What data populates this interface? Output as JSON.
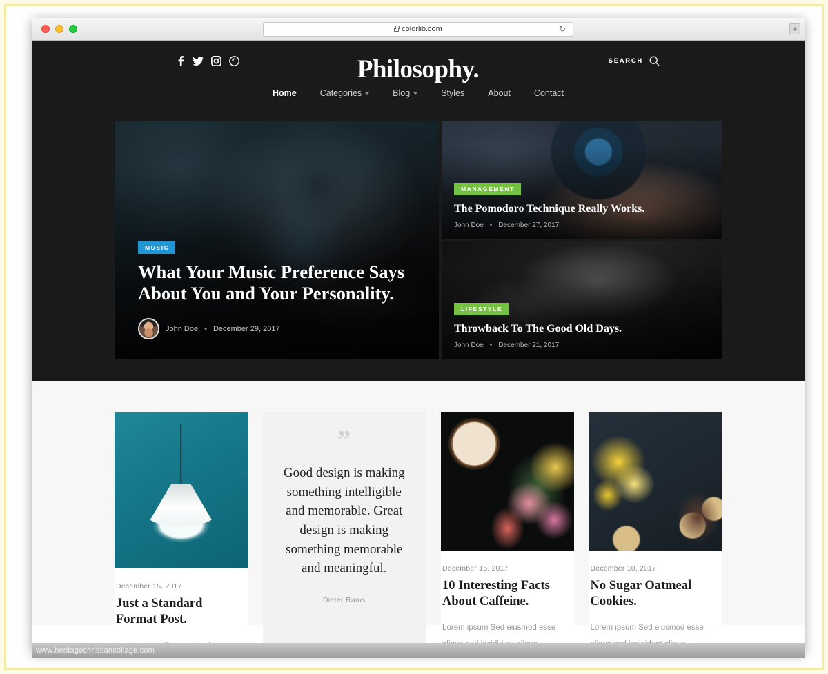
{
  "browser": {
    "url": "colorlib.com",
    "lock_icon": "lock-icon",
    "reload_icon": "↻",
    "new_tab_icon": "+",
    "traffic_lights": [
      "close",
      "minimize",
      "maximize"
    ]
  },
  "site": {
    "brand": "Philosophy.",
    "search_label": "SEARCH",
    "social": [
      {
        "name": "facebook",
        "icon": "facebook-icon"
      },
      {
        "name": "twitter",
        "icon": "twitter-icon"
      },
      {
        "name": "instagram",
        "icon": "instagram-icon"
      },
      {
        "name": "pinterest",
        "icon": "pinterest-icon"
      }
    ],
    "nav": [
      {
        "label": "Home",
        "active": true,
        "dropdown": false
      },
      {
        "label": "Categories",
        "active": false,
        "dropdown": true
      },
      {
        "label": "Blog",
        "active": false,
        "dropdown": true
      },
      {
        "label": "Styles",
        "active": false,
        "dropdown": false
      },
      {
        "label": "About",
        "active": false,
        "dropdown": false
      },
      {
        "label": "Contact",
        "active": false,
        "dropdown": false
      }
    ]
  },
  "hero": {
    "main": {
      "badge": "MUSIC",
      "badge_color": "#2196d4",
      "title": "What Your Music Preference Says About You and Your Personality.",
      "author": "John Doe",
      "separator": "•",
      "date": "December 29, 2017"
    },
    "side": [
      {
        "badge": "MANAGEMENT",
        "badge_color": "#76c043",
        "title": "The Pomodoro Technique Really Works.",
        "author": "John Doe",
        "separator": "•",
        "date": "December 27, 2017"
      },
      {
        "badge": "LIFESTYLE",
        "badge_color": "#76c043",
        "title": "Throwback To The Good Old Days.",
        "author": "John Doe",
        "separator": "•",
        "date": "December 21, 2017"
      }
    ]
  },
  "posts": [
    {
      "date": "December 15, 2017",
      "title": "Just a Standard Format Post.",
      "excerpt": "Lorem ipsum Sed eiusmod esse"
    },
    {
      "date": "December 15, 2017",
      "title": "10 Interesting Facts About Caffeine.",
      "excerpt": "Lorem ipsum Sed eiusmod esse aliqua sed incididunt aliqua incididunt mollit id et sit proident"
    },
    {
      "date": "December 10, 2017",
      "title": "No Sugar Oatmeal Cookies.",
      "excerpt": "Lorem ipsum Sed eiusmod esse aliqua sed incididunt aliqua incididunt mollit id et sit proident"
    }
  ],
  "quote": {
    "mark": "”",
    "text": "Good design is making something intelligible and memorable. Great design is making something memorable and meaningful.",
    "author": "Dieter Rams"
  },
  "watermark": {
    "text": "www.heritagechristiancollage.com"
  }
}
